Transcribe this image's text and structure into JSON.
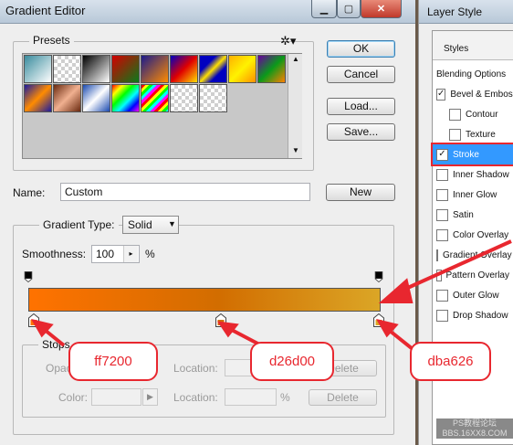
{
  "gradient_editor": {
    "title": "Gradient Editor",
    "presets_label": "Presets",
    "buttons": {
      "ok": "OK",
      "cancel": "Cancel",
      "load": "Load...",
      "save": "Save...",
      "new": "New"
    },
    "name_label": "Name:",
    "name_value": "Custom",
    "gradient_type_label": "Gradient Type:",
    "gradient_type_value": "Solid",
    "smoothness_label": "Smoothness:",
    "smoothness_value": "100",
    "smoothness_unit": "%",
    "gradient_colors": [
      "#ff7200",
      "#d26d00",
      "#dba626"
    ],
    "stops": {
      "label": "Stops",
      "opacity_label": "Opacity:",
      "location_label": "Location:",
      "color_label": "Color:",
      "percent": "%",
      "delete": "Delete"
    }
  },
  "callouts": [
    "ff7200",
    "d26d00",
    "dba626"
  ],
  "layer_style": {
    "title": "Layer Style",
    "styles_header": "Styles",
    "items": [
      {
        "label": "Blending Options",
        "checkbox": false,
        "checked": false
      },
      {
        "label": "Bevel & Emboss",
        "checkbox": true,
        "checked": true
      },
      {
        "label": "Contour",
        "checkbox": true,
        "checked": false
      },
      {
        "label": "Texture",
        "checkbox": true,
        "checked": false
      },
      {
        "label": "Stroke",
        "checkbox": true,
        "checked": true
      },
      {
        "label": "Inner Shadow",
        "checkbox": true,
        "checked": false
      },
      {
        "label": "Inner Glow",
        "checkbox": true,
        "checked": false
      },
      {
        "label": "Satin",
        "checkbox": true,
        "checked": false
      },
      {
        "label": "Color Overlay",
        "checkbox": true,
        "checked": false
      },
      {
        "label": "Gradient Overlay",
        "checkbox": true,
        "checked": false
      },
      {
        "label": "Pattern Overlay",
        "checkbox": true,
        "checked": false
      },
      {
        "label": "Outer Glow",
        "checkbox": true,
        "checked": false
      },
      {
        "label": "Drop Shadow",
        "checkbox": true,
        "checked": false
      }
    ]
  },
  "watermark": "PS教程论坛\nBBS.16XX8.COM"
}
